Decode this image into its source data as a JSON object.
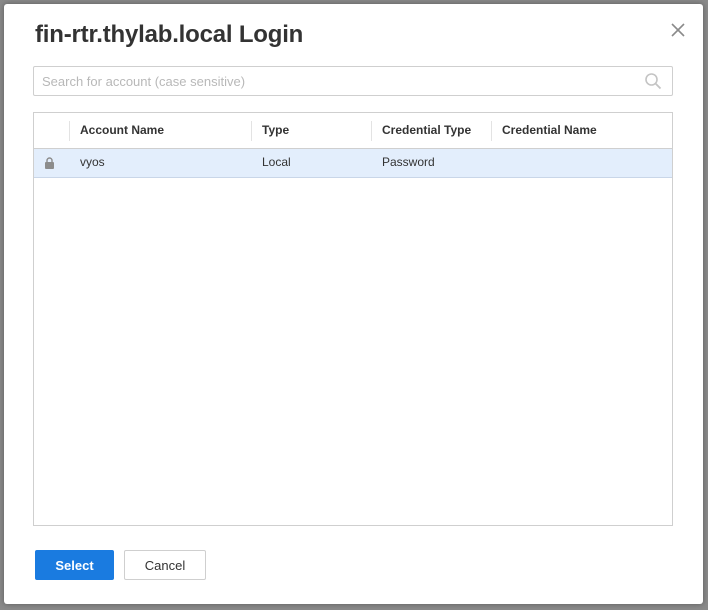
{
  "dialog": {
    "title": "fin-rtr.thylab.local Login",
    "close_icon": "close-icon"
  },
  "search": {
    "placeholder": "Search for account (case sensitive)",
    "value": "",
    "icon": "search-icon"
  },
  "table": {
    "columns": [
      "Account Name",
      "Type",
      "Credential Type",
      "Credential Name"
    ],
    "rows": [
      {
        "icon": "lock-icon",
        "account_name": "vyos",
        "type": "Local",
        "credential_type": "Password",
        "credential_name": "",
        "selected": true
      }
    ]
  },
  "buttons": {
    "select_label": "Select",
    "cancel_label": "Cancel"
  },
  "colors": {
    "primary": "#1a7be0",
    "selected_row": "#e3eefc"
  }
}
